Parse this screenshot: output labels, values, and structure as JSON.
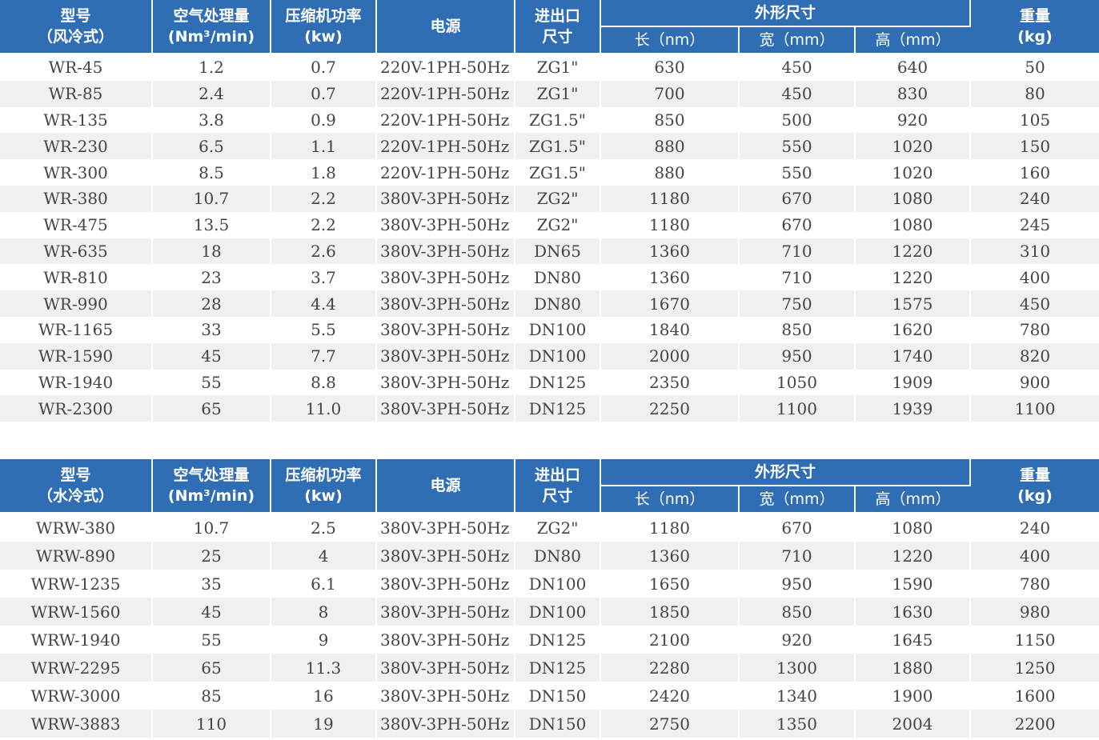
{
  "air_table": {
    "headers": {
      "model": [
        "型号",
        "（风冷式）"
      ],
      "air_capacity": [
        "空气处理量",
        "(Nm³/min)"
      ],
      "compressor_power": [
        "压缩机功率",
        "(kw)"
      ],
      "power_supply": "电源",
      "port": [
        "进出口",
        "尺寸"
      ],
      "dimensions": "外形尺寸",
      "length": "长（nm）",
      "width": "宽（mm）",
      "height": "高（mm）",
      "weight": [
        "重量",
        "(kg)"
      ]
    },
    "rows": [
      [
        "WR-45",
        "1.2",
        "0.7",
        "220V-1PH-50Hz",
        "ZG1\"",
        "630",
        "450",
        "640",
        "50"
      ],
      [
        "WR-85",
        "2.4",
        "0.7",
        "220V-1PH-50Hz",
        "ZG1\"",
        "700",
        "450",
        "830",
        "80"
      ],
      [
        "WR-135",
        "3.8",
        "0.9",
        "220V-1PH-50Hz",
        "ZG1.5\"",
        "850",
        "500",
        "920",
        "105"
      ],
      [
        "WR-230",
        "6.5",
        "1.1",
        "220V-1PH-50Hz",
        "ZG1.5\"",
        "880",
        "550",
        "1020",
        "150"
      ],
      [
        "WR-300",
        "8.5",
        "1.8",
        "220V-1PH-50Hz",
        "ZG1.5\"",
        "880",
        "550",
        "1020",
        "160"
      ],
      [
        "WR-380",
        "10.7",
        "2.2",
        "380V-3PH-50Hz",
        "ZG2\"",
        "1180",
        "670",
        "1080",
        "240"
      ],
      [
        "WR-475",
        "13.5",
        "2.2",
        "380V-3PH-50Hz",
        "ZG2\"",
        "1180",
        "670",
        "1080",
        "245"
      ],
      [
        "WR-635",
        "18",
        "2.6",
        "380V-3PH-50Hz",
        "DN65",
        "1360",
        "710",
        "1220",
        "310"
      ],
      [
        "WR-810",
        "23",
        "3.7",
        "380V-3PH-50Hz",
        "DN80",
        "1360",
        "710",
        "1220",
        "400"
      ],
      [
        "WR-990",
        "28",
        "4.4",
        "380V-3PH-50Hz",
        "DN80",
        "1670",
        "750",
        "1575",
        "450"
      ],
      [
        "WR-1165",
        "33",
        "5.5",
        "380V-3PH-50Hz",
        "DN100",
        "1840",
        "850",
        "1620",
        "780"
      ],
      [
        "WR-1590",
        "45",
        "7.7",
        "380V-3PH-50Hz",
        "DN100",
        "2000",
        "950",
        "1740",
        "820"
      ],
      [
        "WR-1940",
        "55",
        "8.8",
        "380V-3PH-50Hz",
        "DN125",
        "2350",
        "1050",
        "1909",
        "900"
      ],
      [
        "WR-2300",
        "65",
        "11.0",
        "380V-3PH-50Hz",
        "DN125",
        "2250",
        "1100",
        "1939",
        "1100"
      ]
    ]
  },
  "water_table": {
    "headers": {
      "model": [
        "型号",
        "（水冷式）"
      ],
      "air_capacity": [
        "空气处理量",
        "(Nm³/min)"
      ],
      "compressor_power": [
        "压缩机功率",
        "(kw)"
      ],
      "power_supply": "电源",
      "port": [
        "进出口",
        "尺寸"
      ],
      "dimensions": "外形尺寸",
      "length": "长（nm）",
      "width": "宽（mm）",
      "height": "高（mm）",
      "weight": [
        "重量",
        "(kg)"
      ]
    },
    "rows": [
      [
        "WRW-380",
        "10.7",
        "2.5",
        "380V-3PH-50Hz",
        "ZG2\"",
        "1180",
        "670",
        "1080",
        "240"
      ],
      [
        "WRW-890",
        "25",
        "4",
        "380V-3PH-50Hz",
        "DN80",
        "1360",
        "710",
        "1220",
        "400"
      ],
      [
        "WRW-1235",
        "35",
        "6.1",
        "380V-3PH-50Hz",
        "DN100",
        "1650",
        "950",
        "1590",
        "780"
      ],
      [
        "WRW-1560",
        "45",
        "8",
        "380V-3PH-50Hz",
        "DN100",
        "1850",
        "850",
        "1630",
        "980"
      ],
      [
        "WRW-1940",
        "55",
        "9",
        "380V-3PH-50Hz",
        "DN125",
        "2100",
        "920",
        "1645",
        "1150"
      ],
      [
        "WRW-2295",
        "65",
        "11.3",
        "380V-3PH-50Hz",
        "DN125",
        "2280",
        "1300",
        "1880",
        "1250"
      ],
      [
        "WRW-3000",
        "85",
        "16",
        "380V-3PH-50Hz",
        "DN150",
        "2420",
        "1340",
        "1900",
        "1600"
      ],
      [
        "WRW-3883",
        "110",
        "19",
        "380V-3PH-50Hz",
        "DN150",
        "2750",
        "1350",
        "2004",
        "2200"
      ]
    ]
  },
  "colors": {
    "header_bg": "#2f6db5",
    "header_text": "#ffffff",
    "row_alt_bg": "#f0f0f0",
    "cell_text": "#444444"
  }
}
